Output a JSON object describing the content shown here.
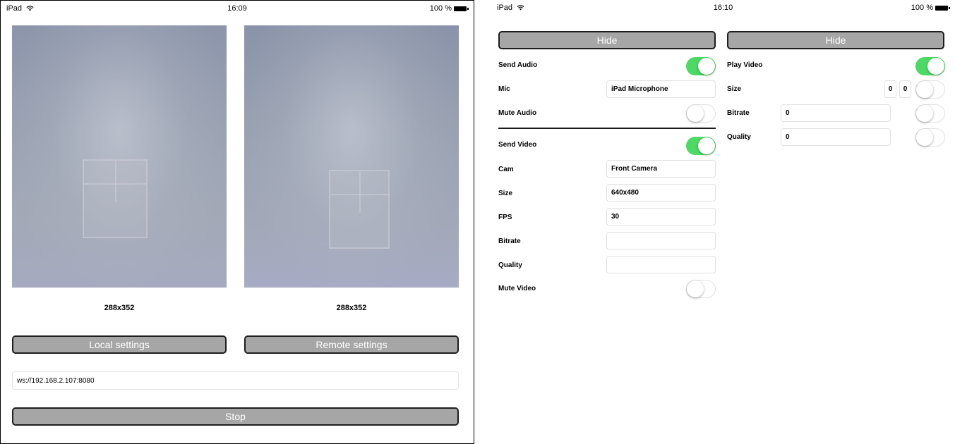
{
  "left_screen": {
    "status_bar": {
      "device": "iPad",
      "time": "16:09",
      "battery": "100 %"
    },
    "local_video_caption": "288x352",
    "remote_video_caption": "288x352",
    "local_settings_label": "Local settings",
    "remote_settings_label": "Remote settings",
    "server_url": "ws://192.168.2.107:8080",
    "stop_label": "Stop"
  },
  "right_screen": {
    "status_bar": {
      "device": "iPad",
      "time": "16:10",
      "battery": "100 %"
    },
    "local_panel": {
      "hide_label": "Hide",
      "send_audio": {
        "label": "Send Audio",
        "on": true
      },
      "mic": {
        "label": "Mic",
        "value": "iPad Microphone"
      },
      "mute_audio": {
        "label": "Mute Audio",
        "on": false
      },
      "send_video": {
        "label": "Send Video",
        "on": true
      },
      "cam": {
        "label": "Cam",
        "value": "Front Camera"
      },
      "size": {
        "label": "Size",
        "value": "640x480"
      },
      "fps": {
        "label": "FPS",
        "value": "30"
      },
      "bitrate": {
        "label": "Bitrate",
        "value": ""
      },
      "quality": {
        "label": "Quality",
        "value": ""
      },
      "mute_video": {
        "label": "Mute Video",
        "on": false
      }
    },
    "remote_panel": {
      "hide_label": "Hide",
      "play_video": {
        "label": "Play Video",
        "on": true
      },
      "size": {
        "label": "Size",
        "width": "0",
        "height": "0",
        "on": false
      },
      "bitrate": {
        "label": "Bitrate",
        "value": "0",
        "on": false
      },
      "quality": {
        "label": "Quality",
        "value": "0",
        "on": false
      }
    }
  },
  "colors": {
    "toggle_on": "#4cd964",
    "button_fill": "#a6a6a6",
    "button_border": "#1e1e1e"
  }
}
